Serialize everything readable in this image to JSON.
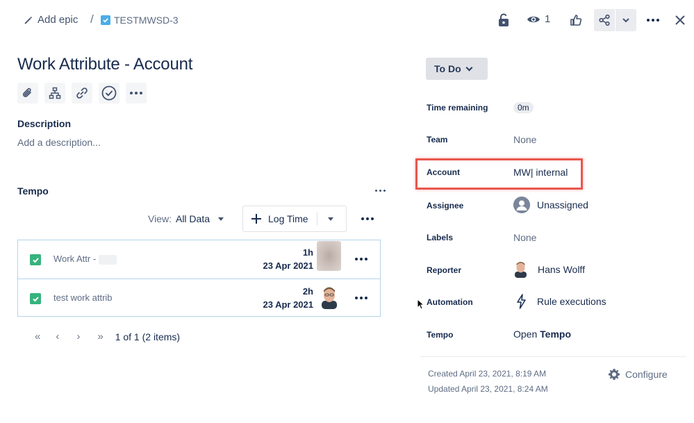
{
  "header": {
    "add_epic": "Add epic",
    "separator": "/",
    "issue_key": "TESTMWSD-3",
    "watch_count": "1"
  },
  "issue": {
    "title": "Work Attribute - Account"
  },
  "description": {
    "heading": "Description",
    "placeholder": "Add a description..."
  },
  "tempo": {
    "heading": "Tempo",
    "view_label": "View:",
    "view_value": "All Data",
    "log_time": "Log Time",
    "rows": [
      {
        "description": "Work Attr - ",
        "duration": "1h",
        "date": "23 Apr 2021"
      },
      {
        "description": "test work attrib",
        "duration": "2h",
        "date": "23 Apr 2021"
      }
    ],
    "pagination": "1 of 1 (2 items)"
  },
  "details": {
    "status": "To Do",
    "fields": [
      {
        "label": "Time remaining",
        "value": "0m"
      },
      {
        "label": "Team",
        "value": "None"
      },
      {
        "label": "Account",
        "value": "MW| internal"
      },
      {
        "label": "Assignee",
        "value": "Unassigned"
      },
      {
        "label": "Labels",
        "value": "None"
      },
      {
        "label": "Reporter",
        "value": "Hans Wolff"
      },
      {
        "label": "Automation",
        "value": "Rule executions"
      },
      {
        "label": "Tempo",
        "value_prefix": "Open ",
        "value_strong": "Tempo"
      }
    ],
    "created": "Created April 23, 2021, 8:19 AM",
    "updated": "Updated April 23, 2021, 8:24 AM",
    "configure": "Configure"
  },
  "colors": {
    "highlight": "#e8584e",
    "checkbox": "#36b37e",
    "issue_type": "#4bade8"
  }
}
